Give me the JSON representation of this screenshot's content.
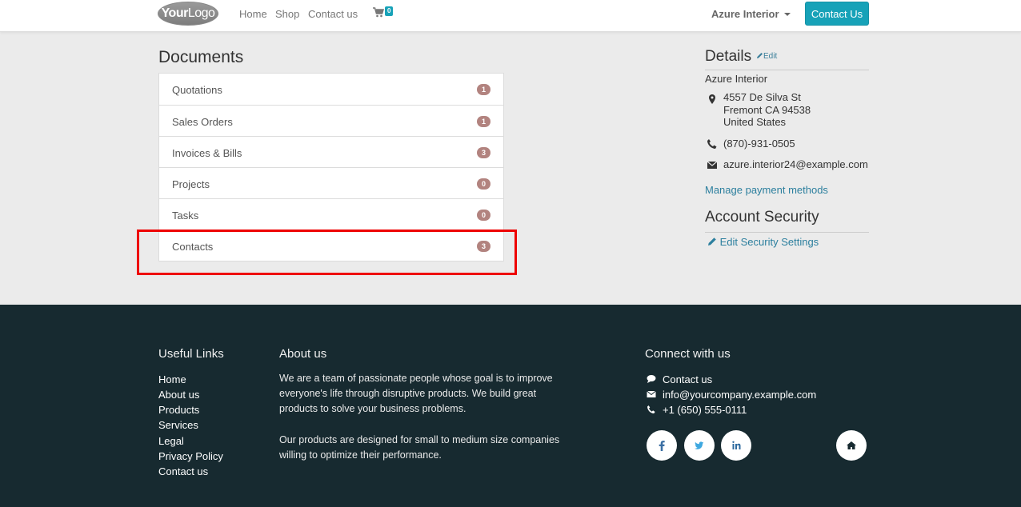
{
  "header": {
    "logo": {
      "your": "Your",
      "logo": "Logo"
    },
    "nav": {
      "home": "Home",
      "shop": "Shop",
      "contact": "Contact us"
    },
    "cart_count": "0",
    "user": "Azure Interior",
    "contact_button": "Contact Us"
  },
  "documents": {
    "title": "Documents",
    "items": [
      {
        "label": "Quotations",
        "count": "1"
      },
      {
        "label": "Sales Orders",
        "count": "1"
      },
      {
        "label": "Invoices & Bills",
        "count": "3"
      },
      {
        "label": "Projects",
        "count": "0"
      },
      {
        "label": "Tasks",
        "count": "0"
      },
      {
        "label": "Contacts",
        "count": "3"
      }
    ]
  },
  "details": {
    "title": "Details",
    "edit": "Edit",
    "name": "Azure Interior",
    "address": [
      "4557 De Silva St",
      "Fremont CA 94538",
      "United States"
    ],
    "phone": "(870)-931-0505",
    "email": "azure.interior24@example.com",
    "manage_payment": "Manage payment methods"
  },
  "security": {
    "title": "Account Security",
    "edit_settings": "Edit Security Settings"
  },
  "footer": {
    "useful_links": {
      "title": "Useful Links",
      "items": [
        "Home",
        "About us",
        "Products",
        "Services",
        "Legal",
        "Privacy Policy",
        "Contact us"
      ]
    },
    "about": {
      "title": "About us",
      "para1": "We are a team of passionate people whose goal is to improve everyone's life through disruptive products. We build great products to solve your business problems.",
      "para2": "Our products are designed for small to medium size companies willing to optimize their performance."
    },
    "connect": {
      "title": "Connect with us",
      "contact": "Contact us",
      "email": "info@yourcompany.example.com",
      "phone": "+1 (650) 555-0111"
    },
    "social_icons": [
      "facebook-icon",
      "twitter-icon",
      "linkedin-icon",
      "home-icon"
    ]
  },
  "colors": {
    "accent": "#17a2b8",
    "badge": "#b2837f",
    "footer_bg": "#172a30",
    "highlight": "#e00000"
  }
}
